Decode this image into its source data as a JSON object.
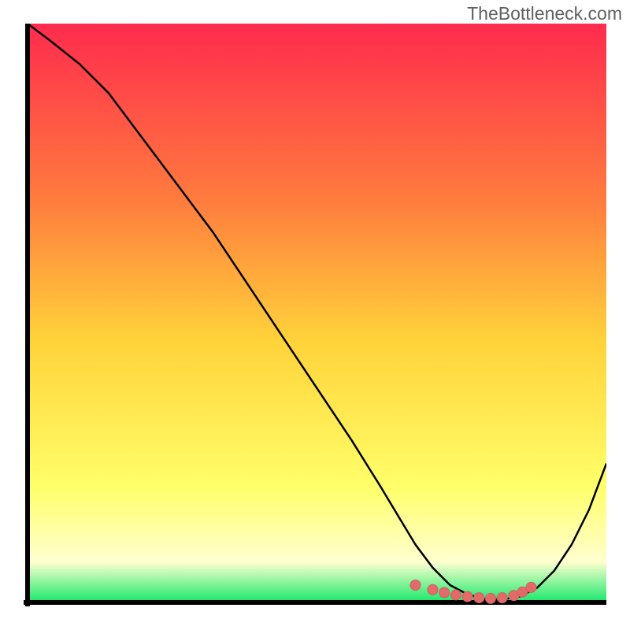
{
  "watermark": "TheBottleneck.com",
  "colors": {
    "gradient_top": "#ff2b4e",
    "gradient_mid_upper": "#ff7a3e",
    "gradient_mid": "#ffd33a",
    "gradient_lower": "#ffff6a",
    "gradient_pale": "#ffffcf",
    "gradient_bottom": "#17e86a",
    "axis": "#000000",
    "curve": "#000000",
    "marker_fill": "#e46a6a",
    "marker_stroke": "#cc5f5f"
  },
  "chart_data": {
    "type": "line",
    "title": "",
    "xlabel": "",
    "ylabel": "",
    "xlim": [
      0,
      100
    ],
    "ylim": [
      0,
      100
    ],
    "curve": {
      "x": [
        0,
        4,
        9,
        14,
        20,
        26,
        32,
        38,
        44,
        50,
        56,
        61,
        64,
        67,
        70,
        73,
        76,
        79,
        82,
        85,
        88,
        91,
        94,
        97,
        100
      ],
      "y": [
        100,
        97,
        93,
        88,
        80,
        72,
        64,
        55,
        46,
        37,
        28,
        20,
        15,
        10,
        6,
        3,
        1.4,
        0.6,
        0.5,
        1.0,
        2.5,
        5.5,
        10,
        16,
        24
      ]
    },
    "markers": {
      "x": [
        67,
        70,
        72,
        74,
        76,
        78,
        80,
        82,
        84,
        85.5,
        87
      ],
      "y": [
        3.0,
        2.2,
        1.7,
        1.3,
        1.0,
        0.8,
        0.7,
        0.8,
        1.2,
        1.8,
        2.6
      ]
    }
  }
}
